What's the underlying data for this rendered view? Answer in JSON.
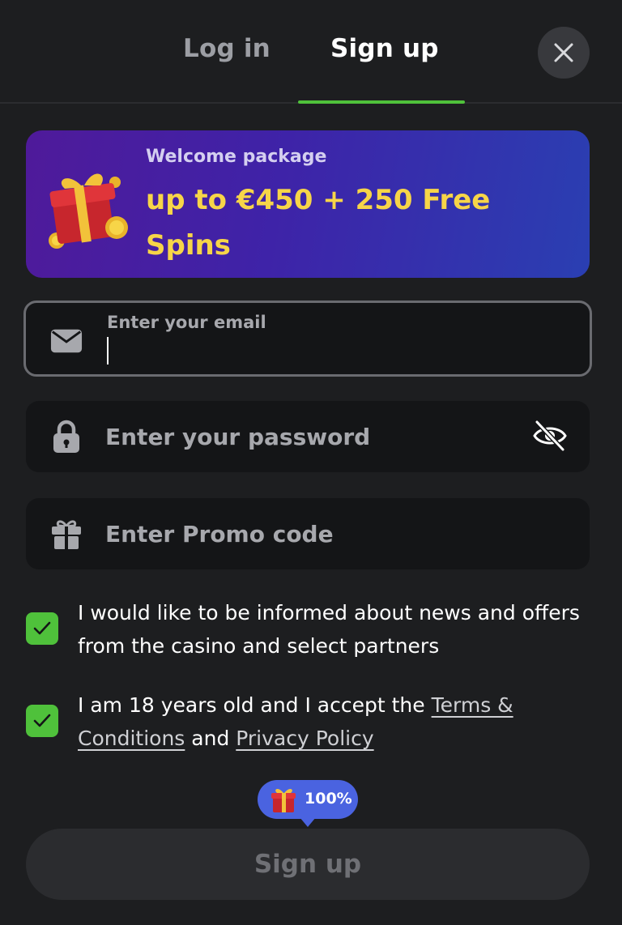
{
  "tabs": {
    "login_label": "Log in",
    "signup_label": "Sign up",
    "active": "Sign up"
  },
  "banner": {
    "subtitle": "Welcome package",
    "title": "up to €450 + 250 Free Spins"
  },
  "form": {
    "email": {
      "label": "Enter your email",
      "value": ""
    },
    "password": {
      "placeholder": "Enter your password",
      "value": ""
    },
    "promo": {
      "placeholder": "Enter Promo code",
      "value": ""
    }
  },
  "consents": {
    "news": {
      "checked": true,
      "text": "I would like to be informed about news and offers from the casino and select partners"
    },
    "terms": {
      "checked": true,
      "prefix": "I am 18 years old and I accept the ",
      "terms_link": "Terms & Conditions",
      "middle": " and ",
      "privacy_link": "Privacy Policy"
    }
  },
  "bonus_badge": {
    "percent": "100%"
  },
  "submit": {
    "label": "Sign up"
  },
  "colors": {
    "background": "#1d1e20",
    "accent": "#4fc13b",
    "banner_highlight": "#f7d548",
    "badge": "#4a63e0"
  },
  "icons": {
    "email": "envelope-icon",
    "password": "lock-icon",
    "promo": "gift-icon",
    "visibility": "eye-off-icon",
    "close": "close-icon"
  }
}
